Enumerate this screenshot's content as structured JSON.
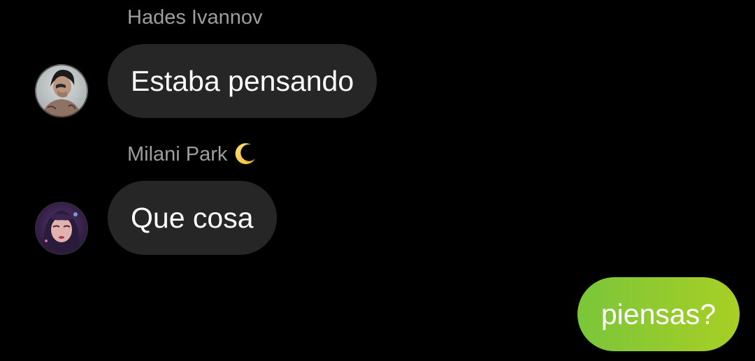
{
  "messages": [
    {
      "sender": "Hades Ivannov",
      "text": "Estaba pensando",
      "avatar_icon": "avatar-hades-photo",
      "direction": "incoming"
    },
    {
      "sender": "Milani Park",
      "sender_emoji": "crescent-moon-icon",
      "text": "Que cosa",
      "avatar_icon": "avatar-milani-photo",
      "direction": "incoming"
    },
    {
      "text": "piensas?",
      "direction": "outgoing"
    }
  ],
  "colors": {
    "background": "#000000",
    "incoming_bubble": "#262626",
    "outgoing_bubble_start": "#7ac63a",
    "outgoing_bubble_end": "#a8cf24",
    "sender_name": "#9e9e9e"
  }
}
